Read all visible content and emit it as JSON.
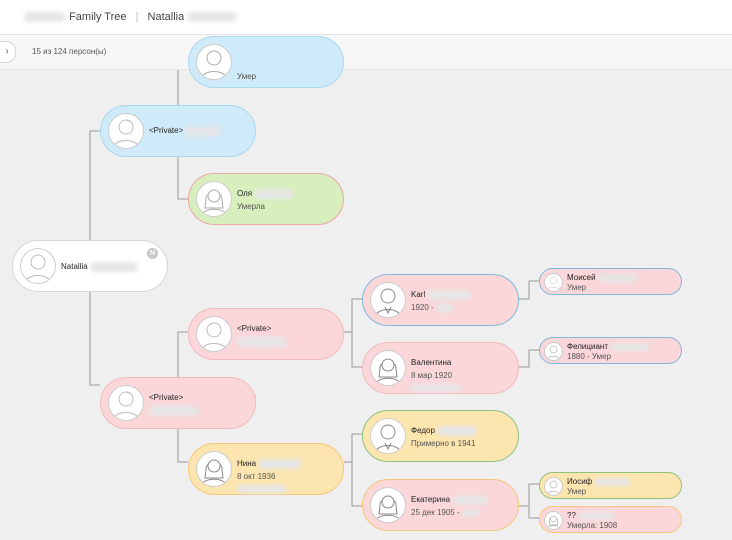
{
  "header": {
    "title": "Family Tree",
    "separator": "|",
    "person": "Natallia"
  },
  "subbar": {
    "toggle_glyph": "›",
    "count": "15 из 124 персон(ы)"
  },
  "nodes": {
    "top_partial": {
      "sub": "Умер"
    },
    "private_blue": {
      "name": "<Private>"
    },
    "olya": {
      "name": "Оля",
      "sub": "Умерла"
    },
    "root": {
      "name": "Natallia",
      "badge": "N"
    },
    "private_upper": {
      "name": "<Private>"
    },
    "private_lower": {
      "name": "<Private>"
    },
    "karl": {
      "name": "Karl",
      "sub": "1920 -"
    },
    "moisey": {
      "name": "Моисей",
      "sub": "Умер"
    },
    "valentina": {
      "name": "Валентина",
      "sub": "8 мар 1920"
    },
    "feliciant": {
      "name": "Фелициант",
      "sub": "1880 - Умер"
    },
    "nina": {
      "name": "Нина",
      "sub": "8 окт 1936"
    },
    "fedor": {
      "name": "Федор",
      "sub": "Примерно в 1941"
    },
    "ekaterina": {
      "name": "Екатерина",
      "sub": "25 дек 1905 -"
    },
    "iosif": {
      "name": "Иосиф",
      "sub": "Умер"
    },
    "unknown": {
      "name": "??",
      "sub": "Умерла: 1908"
    }
  }
}
